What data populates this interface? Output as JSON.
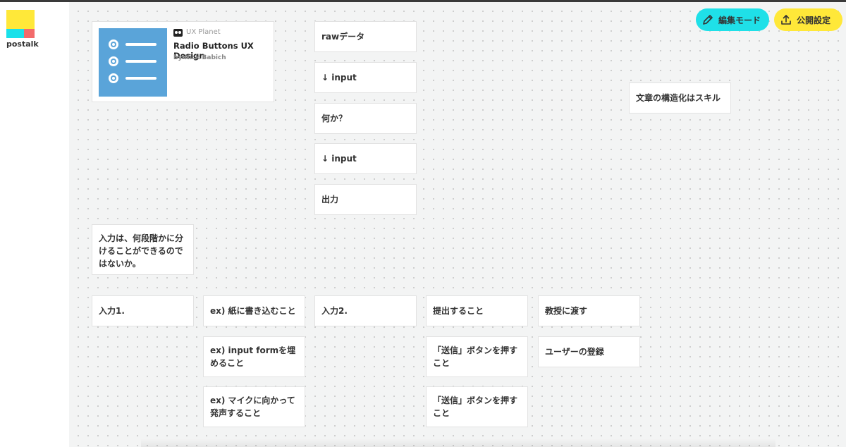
{
  "app": {
    "logo_text": "postalk"
  },
  "toolbar": {
    "edit_mode_label": "編集モード",
    "publish_settings_label": "公開設定"
  },
  "link_card": {
    "site": "UX Planet",
    "title": "Radio Buttons UX Design",
    "author": "by Nick Babich"
  },
  "cards": {
    "raw_data": "rawデータ",
    "arrow_input_1": "↓ input",
    "what": "何か？",
    "arrow_input_2": "↓ input",
    "output": "出力",
    "structuring_skill": "文章の構造化はスキル",
    "input_stages": "入力は、何段階かに分けることができるのではないか。",
    "input1": "入力1.",
    "ex_paper": "ex) 紙に書き込むこと",
    "ex_form": "ex) input formを埋めること",
    "ex_mic": "ex) マイクに向かって発声すること",
    "input2": "入力2.",
    "submit": "提出すること",
    "send_button_1": "「送信」ボタンを押すこと",
    "send_button_2": "「送信」ボタンを押すこと",
    "give_professor": "教授に渡す",
    "user_register": "ユーザーの登録"
  },
  "colors": {
    "edit_button": "#1fe0e8",
    "publish_button": "#ffe839",
    "thumbnail": "#5aa4d9"
  }
}
